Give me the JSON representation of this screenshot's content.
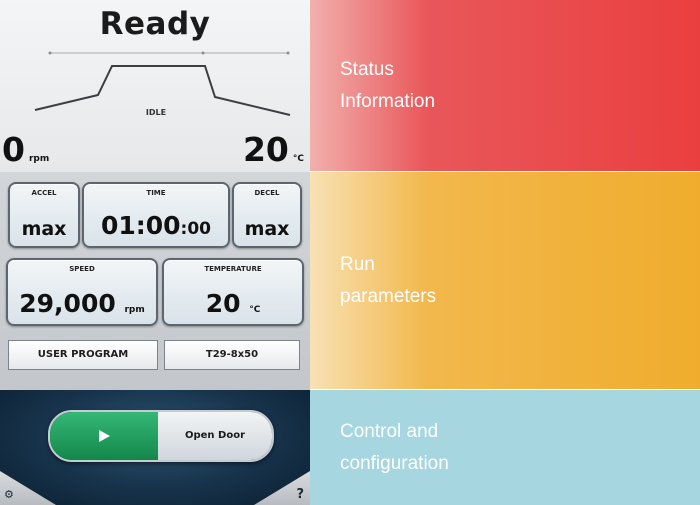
{
  "status": {
    "title": "Ready",
    "profile_label": "IDLE",
    "speed_value": "0",
    "speed_unit": "rpm",
    "temp_value": "20",
    "temp_unit": "°C"
  },
  "params": {
    "accel": {
      "label": "ACCEL",
      "value": "max"
    },
    "time": {
      "label": "TIME",
      "value_main": "01:00",
      "value_small": ":00"
    },
    "decel": {
      "label": "DECEL",
      "value": "max"
    },
    "speed": {
      "label": "SPEED",
      "value": "29,000",
      "unit": "rpm"
    },
    "temperature": {
      "label": "TEMPERATURE",
      "value": "20",
      "unit": "°C"
    },
    "user_program": "USER PROGRAM",
    "rotor": "T29-8x50"
  },
  "control": {
    "start_icon": "play-icon",
    "open_door_label": "Open Door",
    "settings_icon": "settings-icon",
    "settings_glyph": "⚙",
    "help_glyph": "?"
  },
  "bands": {
    "status": {
      "line1": "Status",
      "line2": "Information",
      "color": "#ea3f3f"
    },
    "run": {
      "line1": "Run",
      "line2": "parameters",
      "color": "#f0ad2d"
    },
    "control": {
      "line1": "Control and",
      "line2": "configuration",
      "color": "#a6d6e0"
    }
  }
}
